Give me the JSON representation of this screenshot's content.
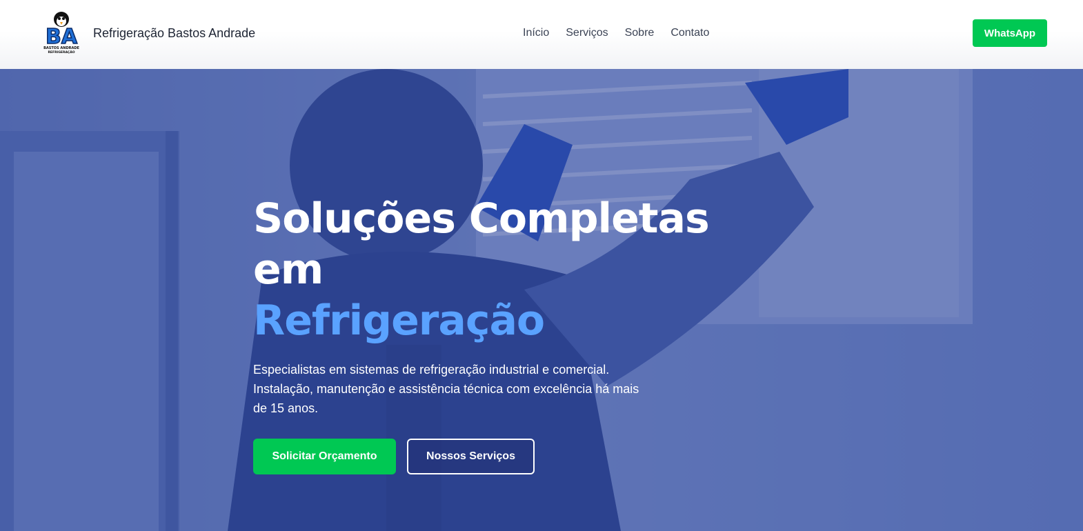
{
  "header": {
    "brand_name": "Refrigeração Bastos Andrade",
    "logo": {
      "initials": "BA",
      "subtitle_line1": "BASTOS ANDRADE",
      "subtitle_line2": "REFRIGERAÇÃO",
      "icon": "penguin-icon"
    },
    "nav": [
      {
        "label": "Início"
      },
      {
        "label": "Serviços"
      },
      {
        "label": "Sobre"
      },
      {
        "label": "Contato"
      }
    ],
    "whatsapp_label": "WhatsApp"
  },
  "hero": {
    "title_line1": "Soluções Completas em",
    "title_line2": "Refrigeração",
    "description": "Especialistas em sistemas de refrigeração industrial e comercial. Instalação, manutenção e assistência técnica com excelência há mais de 15 anos.",
    "primary_button": "Solicitar Orçamento",
    "secondary_button": "Nossos Serviços",
    "background_image": "technician-installing-air-conditioner"
  },
  "colors": {
    "accent_green": "#00c853",
    "accent_blue": "#5aa2ff",
    "hero_overlay": "#2a4296",
    "text_dark": "#1d2433"
  }
}
